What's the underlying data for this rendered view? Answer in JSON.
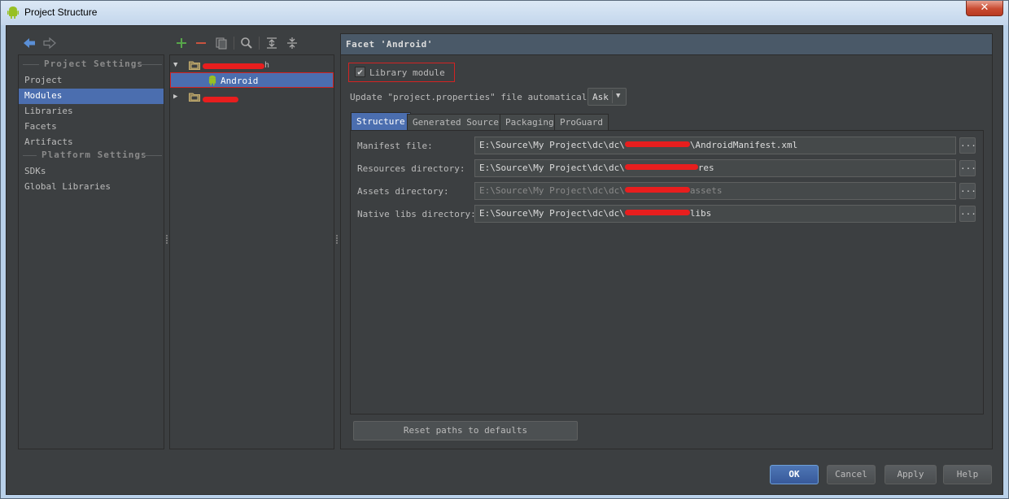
{
  "window": {
    "title": "Project Structure",
    "close_glyph": "✕"
  },
  "nav": {
    "back_icon": "arrow-left-icon",
    "forward_icon": "arrow-right-icon"
  },
  "settings": {
    "project_settings_header": "Project Settings",
    "project_items": [
      "Project",
      "Modules",
      "Libraries",
      "Facets",
      "Artifacts"
    ],
    "selected_item": "Modules",
    "platform_settings_header": "Platform Settings",
    "platform_items": [
      "SDKs",
      "Global Libraries"
    ]
  },
  "tree": {
    "toolbar": [
      "add-icon",
      "remove-icon",
      "copy-icon",
      "search-icon",
      "expand-all-icon",
      "collapse-all-icon"
    ],
    "rows": [
      {
        "label": "",
        "redacted": true,
        "expanded": true
      },
      {
        "label": "Android",
        "selected": true
      },
      {
        "label": "",
        "redacted": true,
        "expanded": false
      }
    ]
  },
  "facet": {
    "header": "Facet 'Android'",
    "library_module_label": "Library module",
    "library_module_checked": true,
    "update_label": "Update \"project.properties\" file automatically:",
    "update_value": "Ask",
    "tabs": [
      "Structure",
      "Generated Sources",
      "Packaging",
      "ProGuard"
    ],
    "active_tab": "Structure",
    "fields": [
      {
        "label": "Manifest file:",
        "prefix": "E:\\Source\\My Project\\dc\\dc\\",
        "suffix": "\\AndroidManifest.xml",
        "enabled": true
      },
      {
        "label": "Resources directory:",
        "prefix": "E:\\Source\\My Project\\dc\\dc\\",
        "suffix": "res",
        "enabled": true
      },
      {
        "label": "Assets directory:",
        "prefix": "E:\\Source\\My Project\\dc\\dc\\",
        "suffix": "assets",
        "enabled": false
      },
      {
        "label": "Native libs directory:",
        "prefix": "E:\\Source\\My Project\\dc\\dc\\",
        "suffix": "libs",
        "enabled": true
      }
    ],
    "browse_label": "...",
    "reset_label": "Reset paths to defaults"
  },
  "footer": {
    "ok": "OK",
    "cancel": "Cancel",
    "apply": "Apply",
    "help": "Help"
  },
  "colors": {
    "accent": "#4b6eaf",
    "redaction": "#e81e1e",
    "panel": "#3c3f41"
  }
}
